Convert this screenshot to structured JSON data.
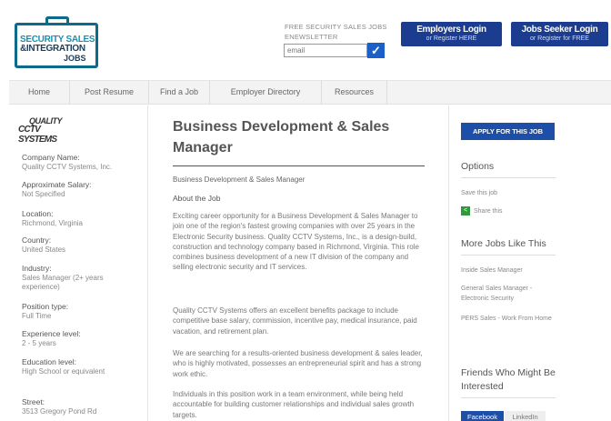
{
  "logo": {
    "line1": "SECURITY SALES",
    "line2": "&INTEGRATION",
    "line3": "JOBS"
  },
  "newsletter": {
    "label": "FREE SECURITY SALES JOBS ENEWSLETTER",
    "placeholder": "email"
  },
  "header_buttons": {
    "employers": {
      "title": "Employers Login",
      "sub": "or Register HERE"
    },
    "seeker": {
      "title": "Jobs Seeker Login",
      "sub": "or Register for FREE"
    }
  },
  "nav": [
    "Home",
    "Post Resume",
    "Find a Job",
    "Employer Directory",
    "Resources"
  ],
  "company_logo": {
    "line1": "QUALITY",
    "line2": "CCTV SYSTEMS"
  },
  "details": [
    {
      "label": "Company Name:",
      "value": "Quality CCTV Systems, Inc."
    },
    {
      "label": "Approximate Salary:",
      "value": "Not Specified"
    },
    {
      "label": "Location:",
      "value": "Richmond, Virginia"
    },
    {
      "label": "Country:",
      "value": "United States"
    },
    {
      "label": "Industry:",
      "value": "Sales Manager (2+ years experience)"
    },
    {
      "label": "Position type:",
      "value": "Full Time"
    },
    {
      "label": "Experience level:",
      "value": "2 - 5 years"
    },
    {
      "label": "Education level:",
      "value": "High School or equivalent"
    },
    {
      "label": "Street:",
      "value": "3513 Gregory Pond Rd"
    }
  ],
  "job": {
    "title": "Business Development & Sales Manager",
    "subtitle": "Business Development & Sales Manager",
    "about_heading": "About the Job",
    "paragraphs": [
      "Exciting career opportunity for a Business Development & Sales Manager to join one of the region's fastest growing companies with over 25 years in the Electronic Security business.  Quality CCTV Systems, Inc., is a design-build, construction and technology company based in Richmond, Virginia.  This role combines business development of a new IT division of the company and selling electronic security and IT services.",
      "Quality CCTV Systems offers an excellent benefits package to include competitive base salary, commission, incentive pay, medical insurance, paid vacation, and retirement plan.",
      "We are searching for a results-oriented business development & sales leader, who is highly motivated, possesses an entrepreneurial spirit and has a strong work ethic.",
      "Individuals in this position work in a team environment, while being held accountable for building customer relationships and individual sales growth targets."
    ]
  },
  "sidebar": {
    "apply_label": "APPLY FOR THIS JOB",
    "options_heading": "Options",
    "save_label": "Save this job",
    "share_label": "Share this",
    "more_heading": "More Jobs Like This",
    "more_jobs": [
      "Inside Sales Manager",
      "General Sales Manager - Electronic Security",
      "PERS Sales - Work From Home"
    ],
    "friends_heading": "Friends Who Might Be Interested",
    "tabs": [
      "Facebook",
      "LinkedIn"
    ]
  },
  "colors": {
    "brand_blue": "#1b3c8f",
    "accent_blue": "#1d4fa8",
    "share_green": "#2e9a3c"
  }
}
